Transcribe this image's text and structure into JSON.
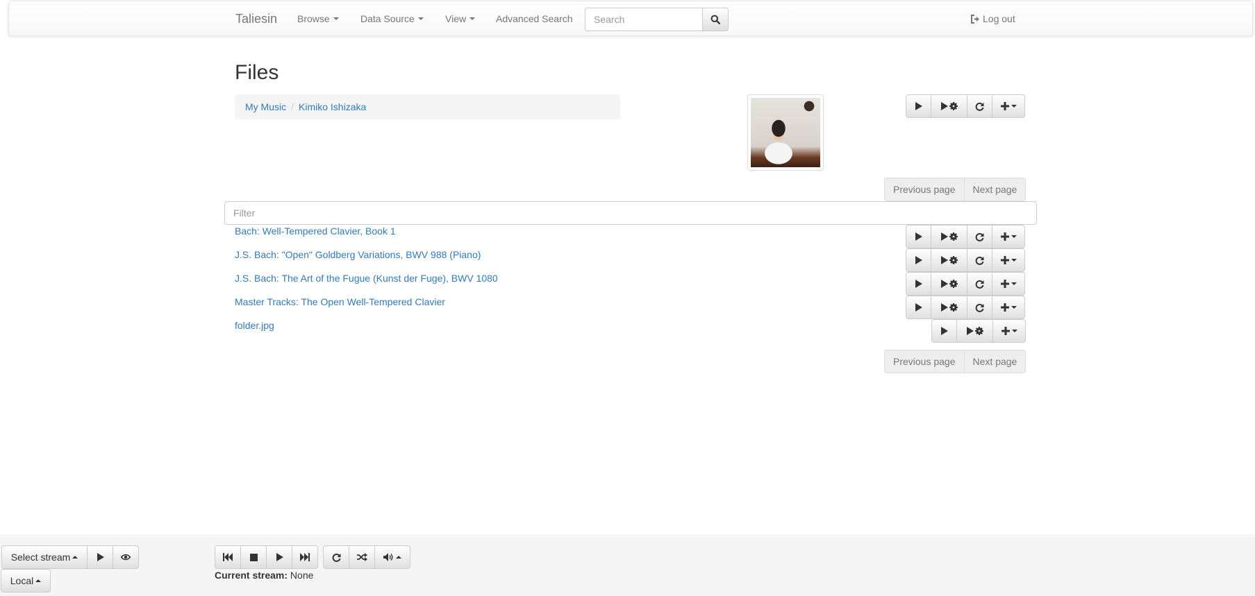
{
  "navbar": {
    "brand": "Taliesin",
    "browse": "Browse",
    "data_source": "Data Source",
    "view": "View",
    "advanced_search": "Advanced Search",
    "search_placeholder": "Search",
    "logout": "Log out"
  },
  "page": {
    "title": "Files",
    "breadcrumb": [
      "My Music",
      "Kimiko Ishizaka"
    ]
  },
  "pager": {
    "previous": "Previous page",
    "next": "Next page"
  },
  "filter": {
    "placeholder": "Filter"
  },
  "files": [
    {
      "name": "Bach: Well-Tempered Clavier, Book 1",
      "type": "folder"
    },
    {
      "name": "J.S. Bach: \"Open\" Goldberg Variations, BWV 988 (Piano)",
      "type": "folder"
    },
    {
      "name": "J.S. Bach: The Art of the Fugue (Kunst der Fuge), BWV 1080",
      "type": "folder"
    },
    {
      "name": "Master Tracks: The Open Well-Tempered Clavier",
      "type": "folder"
    },
    {
      "name": "folder.jpg",
      "type": "file"
    }
  ],
  "player": {
    "select_stream": "Select stream",
    "local": "Local",
    "current_stream_label": "Current stream:",
    "current_stream_value": "None"
  },
  "icons": {
    "play": "play-icon",
    "play_advanced": "play-gear-icon",
    "refresh": "refresh-icon",
    "add": "plus-icon",
    "search": "search-icon",
    "logout": "sign-out-icon",
    "eye": "eye-icon",
    "prev": "fast-backward-icon",
    "stop": "stop-icon",
    "next": "fast-forward-icon",
    "repeat": "repeat-icon",
    "shuffle": "shuffle-icon",
    "volume": "volume-icon"
  }
}
